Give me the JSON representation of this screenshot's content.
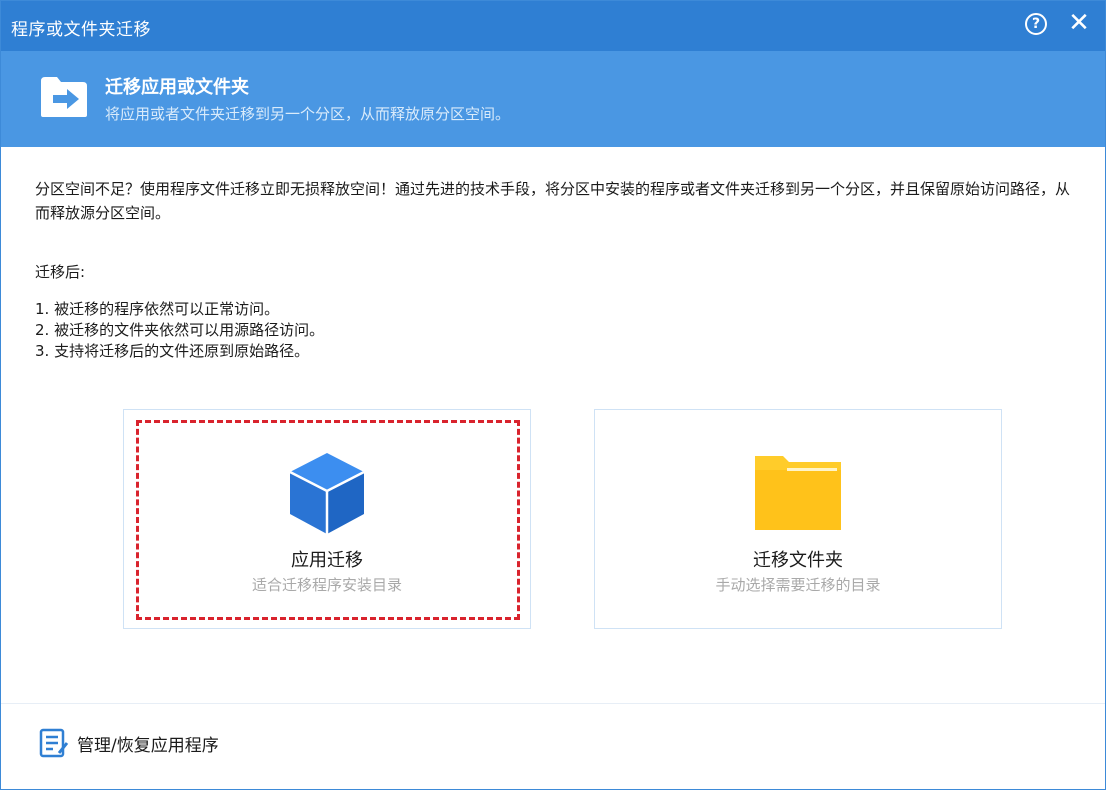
{
  "window": {
    "title": "程序或文件夹迁移",
    "help_symbol": "?",
    "close_symbol": "✕"
  },
  "header": {
    "title": "迁移应用或文件夹",
    "subtitle": "将应用或者文件夹迁移到另一个分区，从而释放原分区空间。",
    "icon": "folder-transfer-icon"
  },
  "intro": {
    "text": "分区空间不足？使用程序文件迁移立即无损释放空间！通过先进的技术手段，将分区中安装的程序或者文件夹迁移到另一个分区，并且保留原始访问路径，从而释放源分区空间。"
  },
  "after": {
    "label": "迁移后:",
    "points": [
      "1. 被迁移的程序依然可以正常访问。",
      "2. 被迁移的文件夹依然可以用源路径访问。",
      "3. 支持将迁移后的文件还原到原始路径。"
    ]
  },
  "cards": [
    {
      "title": "应用迁移",
      "subtitle": "适合迁移程序安装目录",
      "icon": "cube-icon",
      "color": "#2f7fe0"
    },
    {
      "title": "迁移文件夹",
      "subtitle": "手动选择需要迁移的目录",
      "icon": "folder-icon",
      "color": "#ffc21a"
    }
  ],
  "footer": {
    "link_label": "管理/恢复应用程序",
    "icon": "list-icon"
  },
  "colors": {
    "titlebar": "#2f7fd3",
    "header": "#4a97e3",
    "highlight_dash": "#d9232d"
  }
}
